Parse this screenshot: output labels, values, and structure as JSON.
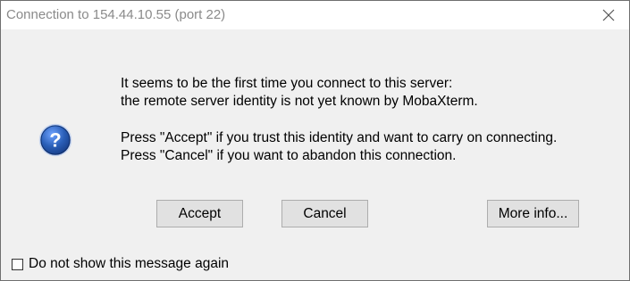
{
  "window": {
    "title": "Connection to 154.44.10.55 (port 22)"
  },
  "icons": {
    "close": "close-icon",
    "question": "question-icon",
    "question_color": "#2a5fb8"
  },
  "message": {
    "line1": "It seems to be the first time you connect to this server:",
    "line2": "the remote server identity is not yet known by MobaXterm.",
    "line3": "Press \"Accept\" if you trust this identity and want to carry on connecting.",
    "line4": "Press \"Cancel\" if you want to abandon this connection."
  },
  "buttons": {
    "accept": "Accept",
    "cancel": "Cancel",
    "more_info": "More info..."
  },
  "checkbox": {
    "label": "Do not show this message again",
    "checked": false
  }
}
